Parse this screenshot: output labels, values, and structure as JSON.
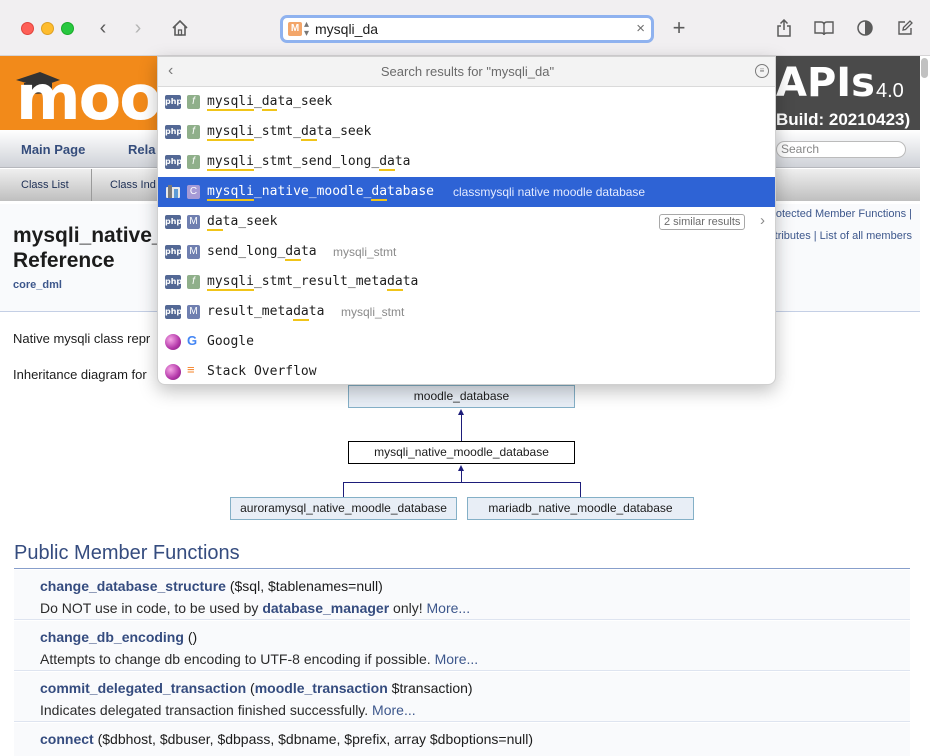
{
  "browser": {
    "address_text": "mysqli_da",
    "favicon_letter": "M"
  },
  "site": {
    "logo_text": "moo",
    "apis": "APIs",
    "version": "4.0",
    "build": "Build: 20210423)",
    "nav": {
      "main_page": "Main Page",
      "related": "Rela",
      "search_placeholder": "Search"
    },
    "subnav": {
      "class_list": "Class List",
      "class_index": "Class Ind"
    }
  },
  "doc": {
    "title_line1": "mysqli_native_",
    "title_line2": "Reference",
    "ingroup": "core_dml",
    "summary_links_1": "rotected Member Functions |",
    "summary_links_2": "tributes | List of all members",
    "intro": "Native mysqli class repr",
    "inheritance_label": "Inheritance diagram for",
    "diagram": {
      "base": "moodle_database",
      "current": "mysqli_native_moodle_database",
      "child1": "auroramysql_native_moodle_database",
      "child2": "mariadb_native_moodle_database"
    },
    "section_title": "Public Member Functions",
    "members": [
      {
        "name": "change_database_structure",
        "args": "($sql, $tablenames=null)",
        "desc_pre": "Do NOT use in code, to be used by ",
        "desc_link": "database_manager",
        "desc_post": " only! ",
        "more": "More..."
      },
      {
        "name": "change_db_encoding",
        "args": "()",
        "desc_pre": "Attempts to change db encoding to UTF-8 encoding if possible. ",
        "desc_link": "",
        "desc_post": "",
        "more": "More..."
      },
      {
        "name": "commit_delegated_transaction",
        "args_link": "moodle_transaction",
        "args": " $transaction)",
        "desc_pre": "Indicates delegated transaction finished successfully. ",
        "desc_link": "",
        "desc_post": "",
        "more": "More..."
      },
      {
        "name": "connect",
        "args": "($dbhost, $dbuser, $dbpass, $dbname, $prefix, array $dboptions=null)"
      }
    ]
  },
  "dropdown": {
    "header": "Search results for \"mysqli_da\"",
    "similar": "2 similar results",
    "rows": [
      {
        "type": "f",
        "pre": "",
        "hl1": "mysqli",
        "mid": "_",
        "hl2": "da",
        "post": "ta_seek",
        "extra": ""
      },
      {
        "type": "f",
        "pre": "",
        "hl1": "mysqli",
        "mid": "_stmt_",
        "hl2": "da",
        "post": "ta_seek",
        "extra": ""
      },
      {
        "type": "f",
        "pre": "",
        "hl1": "mysqli",
        "mid": "_stmt_send_long_",
        "hl2": "da",
        "post": "ta",
        "extra": ""
      },
      {
        "type": "C",
        "pre": "",
        "hl1": "mysqli",
        "mid": "_native_moodle_",
        "hl2": "da",
        "post": "tabase",
        "extra": "classmysqli  native  moodle  database"
      },
      {
        "type": "M",
        "pre": "",
        "hl1": "",
        "mid": "",
        "hl2": "da",
        "post": "ta_seek",
        "extra": ""
      },
      {
        "type": "M",
        "pre": "send_long_",
        "hl1": "",
        "mid": "",
        "hl2": "da",
        "post": "ta",
        "extra": "mysqli_stmt"
      },
      {
        "type": "f",
        "pre": "",
        "hl1": "mysqli",
        "mid": "_stmt_result_meta",
        "hl2": "da",
        "post": "ta",
        "extra": ""
      },
      {
        "type": "M",
        "pre": "result_meta",
        "hl1": "",
        "mid": "",
        "hl2": "da",
        "post": "ta",
        "extra": "mysqli_stmt"
      }
    ],
    "web": [
      {
        "label": "Google"
      },
      {
        "label": "Stack Overflow"
      }
    ]
  }
}
